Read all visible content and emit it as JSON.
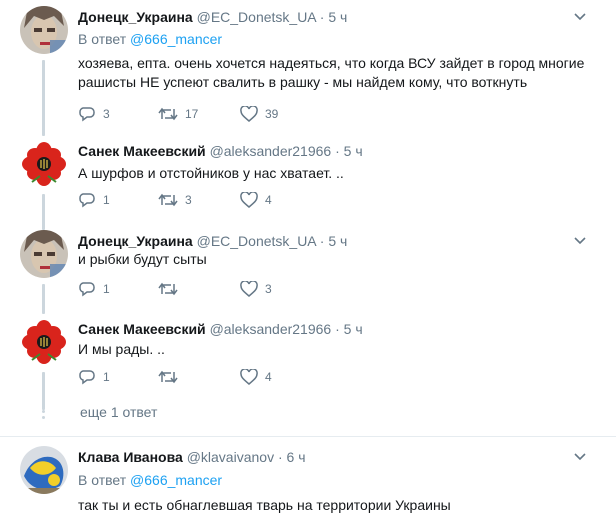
{
  "tweets": [
    {
      "name": "Донецк_Украина",
      "handle": "@EC_Donetsk_UA",
      "sep": "·",
      "time": "5 ч",
      "reply_prefix": "В ответ",
      "reply_to": "@666_mancer",
      "text": "хозяева, епта. очень хочется надеяться, что когда ВСУ зайдет в город многие",
      "text2": "рашисты НЕ успеют свалить в рашку - мы найдем кому, что воткнуть",
      "replies": "3",
      "retweets": "17",
      "likes": "39"
    },
    {
      "name": "Санек Макеевский",
      "handle": "@aleksander21966",
      "sep": "·",
      "time": "5 ч",
      "text": "А шурфов  и отстойников у нас хватает. ..",
      "replies": "1",
      "retweets": "3",
      "likes": "4"
    },
    {
      "name": "Донецк_Украина",
      "handle": "@EC_Donetsk_UA",
      "sep": "·",
      "time": "5 ч",
      "text": "и рыбки будут сыты",
      "replies": "1",
      "retweets": "",
      "likes": "3"
    },
    {
      "name": "Санек Макеевский",
      "handle": "@aleksander21966",
      "sep": "·",
      "time": "5 ч",
      "text": "И мы рады. ..",
      "replies": "1",
      "retweets": "",
      "likes": "4"
    },
    {
      "name": "Клава Иванова",
      "handle": "@klavaivanov",
      "sep": "·",
      "time": "6 ч",
      "reply_prefix": "В ответ",
      "reply_to": "@666_mancer",
      "text": "так ты и есть обнаглевшая тварь на территории Украины"
    }
  ],
  "more_replies": "еще 1 ответ",
  "colors": {
    "accent": "#1da1f2",
    "muted": "#657786",
    "text": "#14171a",
    "line": "#ccd6dd"
  }
}
